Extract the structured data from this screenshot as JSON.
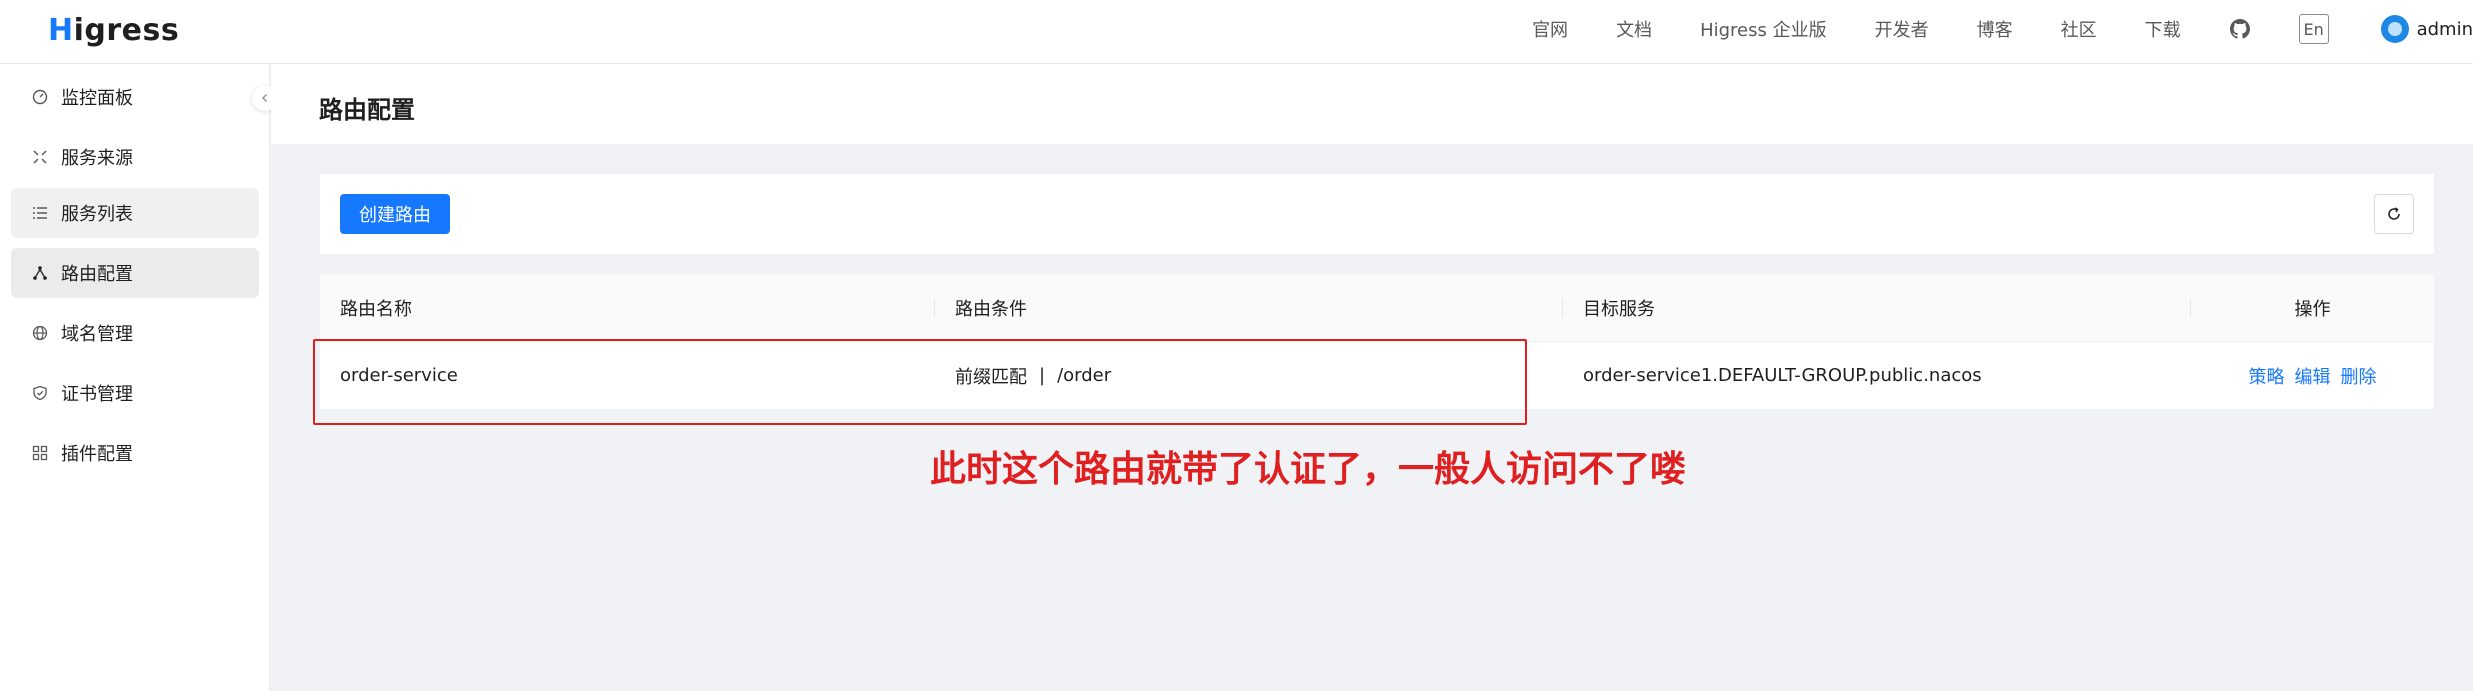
{
  "header": {
    "logo_first": "H",
    "logo_rest": "igress",
    "nav": [
      "官网",
      "文档",
      "Higress 企业版",
      "开发者",
      "博客",
      "社区",
      "下载"
    ],
    "lang": "En",
    "user": "admin"
  },
  "sidebar": {
    "items": [
      {
        "label": "监控面板",
        "icon": "dashboard-icon"
      },
      {
        "label": "服务来源",
        "icon": "service-source-icon"
      },
      {
        "label": "服务列表",
        "icon": "list-icon"
      },
      {
        "label": "路由配置",
        "icon": "route-icon"
      },
      {
        "label": "域名管理",
        "icon": "globe-icon"
      },
      {
        "label": "证书管理",
        "icon": "shield-icon"
      },
      {
        "label": "插件配置",
        "icon": "plugin-icon"
      }
    ],
    "active_index": 3
  },
  "page": {
    "title": "路由配置",
    "create_button": "创建路由"
  },
  "table": {
    "columns": [
      "路由名称",
      "路由条件",
      "目标服务",
      "操作"
    ],
    "rows": [
      {
        "name": "order-service",
        "match_type": "前缀匹配",
        "path": "/order",
        "target": "order-service1.DEFAULT-GROUP.public.nacos",
        "actions": [
          "策略",
          "编辑",
          "删除"
        ]
      }
    ]
  },
  "annotation": "此时这个路由就带了认证了，一般人访问不了喽",
  "colors": {
    "primary": "#1677ff",
    "annotation": "#e02020"
  }
}
